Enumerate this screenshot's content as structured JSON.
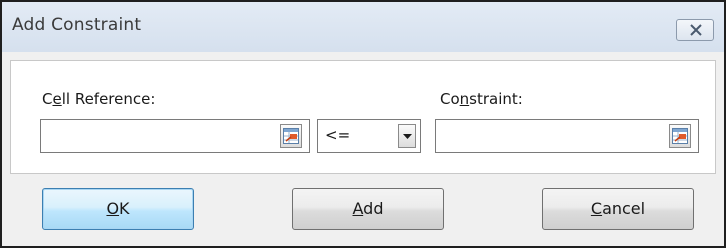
{
  "dialog": {
    "title": "Add Constraint",
    "close_icon": "close-icon"
  },
  "fields": {
    "cell_reference": {
      "label_prefix": "C",
      "label_access_key": "e",
      "label_suffix": "ll Reference:",
      "value": "",
      "collapse_icon": "range-select-icon"
    },
    "operator": {
      "value": "<=",
      "dropdown_icon": "chevron-down-icon"
    },
    "constraint": {
      "label_prefix": "Co",
      "label_access_key": "n",
      "label_suffix": "straint:",
      "value": "",
      "collapse_icon": "range-select-icon"
    }
  },
  "buttons": {
    "ok": {
      "access_key": "O",
      "rest": "K"
    },
    "add": {
      "access_key": "A",
      "rest": "dd"
    },
    "cancel": {
      "access_key": "C",
      "rest": "ancel"
    }
  }
}
